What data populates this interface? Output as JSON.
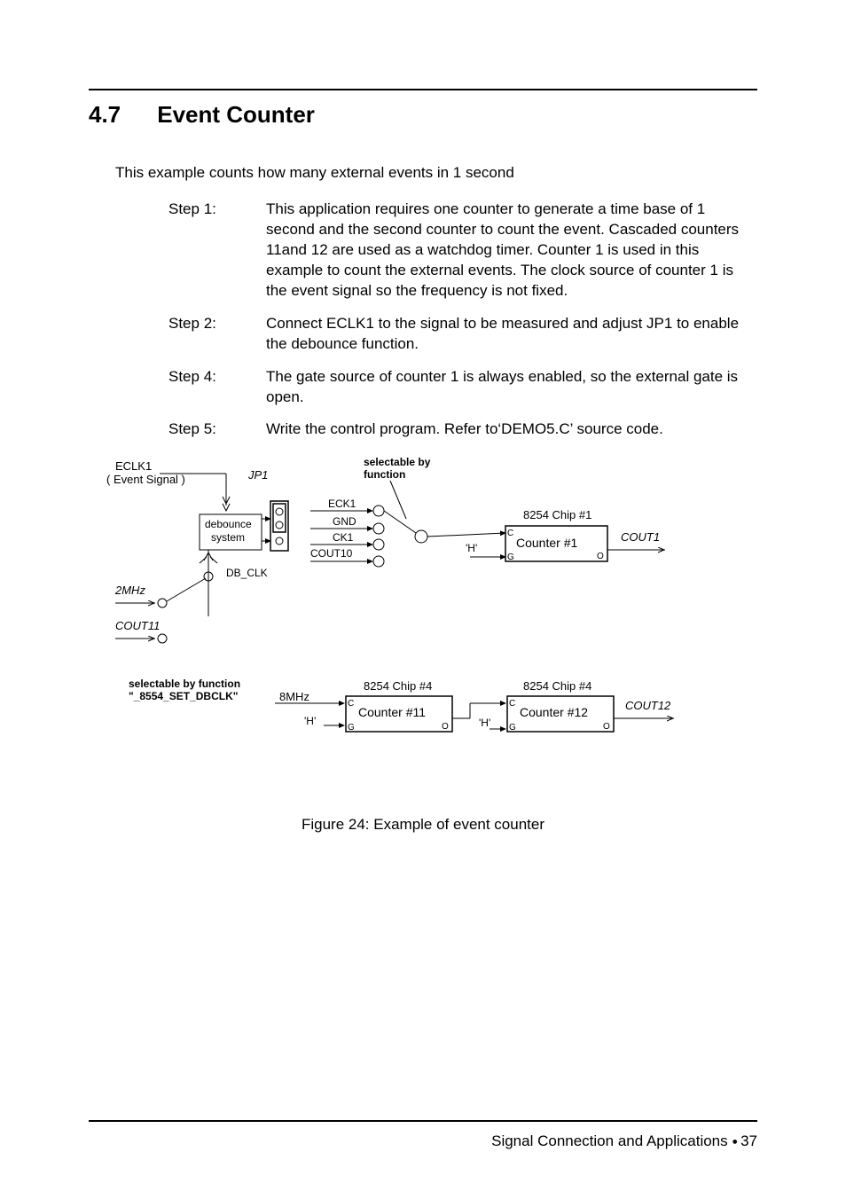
{
  "heading": {
    "number": "4.7",
    "title": "Event Counter"
  },
  "intro": "This example counts how many external events in 1 second",
  "steps": [
    {
      "label": "Step 1:",
      "text": "This application requires one counter to generate a time base of 1 second and the second counter to count the event.  Cascaded counters 11and 12 are used as a watchdog timer.  Counter 1 is used in this example to count the external events.  The clock source of counter 1 is the event signal so the frequency is not fixed."
    },
    {
      "label": "Step 2:",
      "text": "Connect ECLK1 to the signal to be measured and adjust JP1 to enable the debounce function."
    },
    {
      "label": "Step 4:",
      "text": "The gate source of counter 1 is always enabled, so the external gate is open."
    },
    {
      "label": "Step 5:",
      "text": " Write the control program.  Refer to‘DEMO5.C’ source code."
    }
  ],
  "diagram": {
    "eclk1_a": "ECLK1",
    "eclk1_b": "( Event Signal )",
    "jp1": "JP1",
    "selnote_a": "selectable by",
    "selnote_b": "function",
    "debounce_a": "debounce",
    "debounce_b": "system",
    "eck1": "ECK1",
    "gnd": "GND",
    "ck1": "CK1",
    "cout10": "COUT10",
    "db_clk": "DB_CLK",
    "twoMHz": "2MHz",
    "cout11": "COUT11",
    "chip1": "8254 Chip #1",
    "counter1": "Counter #1",
    "cout1": "COUT1",
    "h1": "'H'",
    "c1": "C",
    "o1": "O",
    "g1": "G",
    "selfunc_a": "selectable by function",
    "selfunc_b": "\"_8554_SET_DBCLK\"",
    "eightMHz": "8MHz",
    "h2": "'H'",
    "chip4a": "8254 Chip #4",
    "counter11": "Counter #11",
    "c2": "C",
    "o2": "O",
    "g2": "G",
    "chip4b": "8254 Chip #4",
    "counter12": "Counter #12",
    "cout12": "COUT12",
    "h3": "'H'",
    "c3": "C",
    "o3": "O",
    "g3": "G"
  },
  "figure_caption": "Figure 24:   Example of event counter",
  "footer": {
    "text": "Signal Connection and Applications",
    "page": "37"
  }
}
